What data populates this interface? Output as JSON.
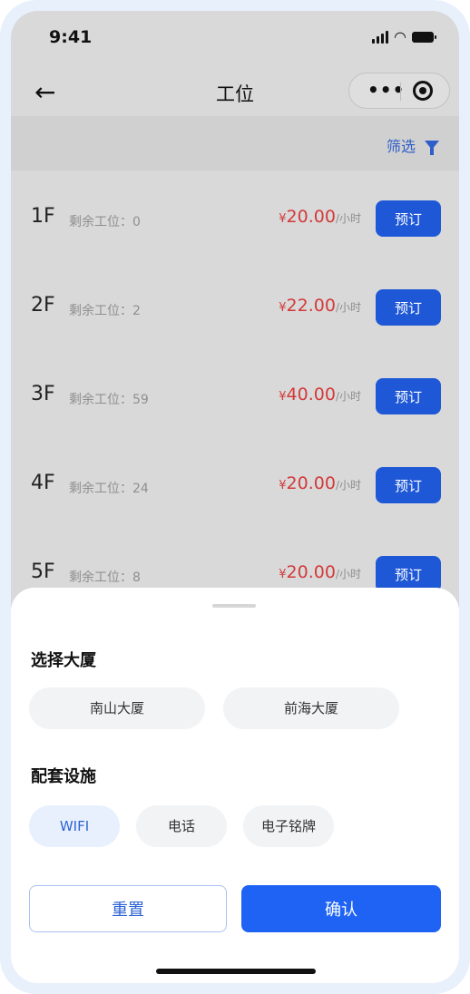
{
  "status_bar": {
    "time": "9:41"
  },
  "nav": {
    "title": "工位",
    "more_label": "•••"
  },
  "filter": {
    "label": "筛选"
  },
  "rows": [
    {
      "floor": "1F",
      "remaining_label": "剩余工位：0",
      "currency": "¥",
      "price": "20.00",
      "unit": "/小时",
      "book_label": "预订"
    },
    {
      "floor": "2F",
      "remaining_label": "剩余工位：2",
      "currency": "¥",
      "price": "22.00",
      "unit": "/小时",
      "book_label": "预订"
    },
    {
      "floor": "3F",
      "remaining_label": "剩余工位：59",
      "currency": "¥",
      "price": "40.00",
      "unit": "/小时",
      "book_label": "预订"
    },
    {
      "floor": "4F",
      "remaining_label": "剩余工位：24",
      "currency": "¥",
      "price": "20.00",
      "unit": "/小时",
      "book_label": "预订"
    },
    {
      "floor": "5F",
      "remaining_label": "剩余工位：8",
      "currency": "¥",
      "price": "20.00",
      "unit": "/小时",
      "book_label": "预订"
    }
  ],
  "sheet": {
    "building_title": "选择大厦",
    "buildings": [
      "南山大厦",
      "前海大厦"
    ],
    "facilities_title": "配套设施",
    "facilities": [
      "WIFI",
      "电话",
      "电子铭牌"
    ],
    "selected_facility": "WIFI",
    "reset_label": "重置",
    "confirm_label": "确认"
  },
  "colors": {
    "primary": "#1f63f5",
    "price": "#d33a3a",
    "overlay": "#d9d9d9"
  }
}
